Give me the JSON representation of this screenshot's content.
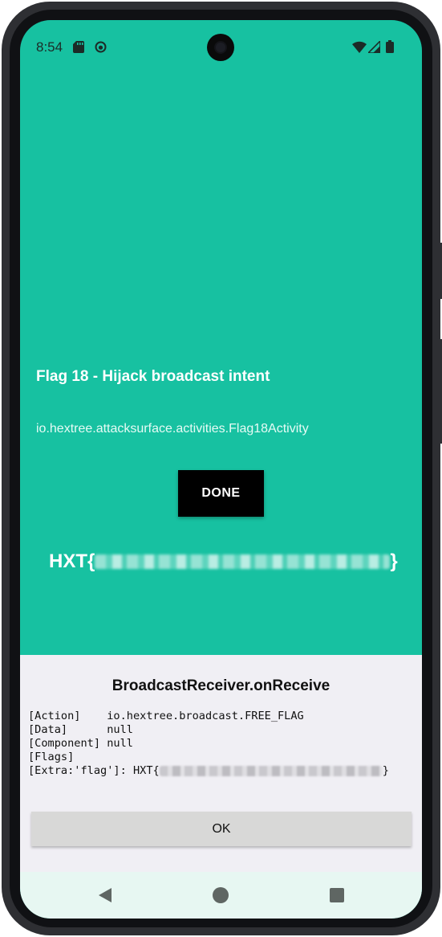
{
  "status_bar": {
    "time": "8:54",
    "left_icons": [
      "sd-card-icon",
      "sync-face-icon"
    ],
    "right_icons": [
      "wifi-icon",
      "cellular-signal-icon",
      "battery-icon"
    ]
  },
  "app": {
    "title": "Flag 18 - Hijack broadcast intent",
    "activity_class": "io.hextree.attacksurface.activities.Flag18Activity",
    "done_label": "DONE",
    "flag_prefix": "HXT{",
    "flag_suffix": "}",
    "background_color": "#17c1a1"
  },
  "dialog": {
    "title": "BroadcastReceiver.onReceive",
    "lines": [
      "[Action]    io.hextree.broadcast.FREE_FLAG",
      "[Data]      null",
      "[Component] null",
      "[Flags]"
    ],
    "extra_prefix": "[Extra:'flag']: HXT{",
    "extra_suffix": "}",
    "ok_label": "OK"
  },
  "nav_bar": {
    "icons": [
      "back-icon",
      "home-icon",
      "recents-icon"
    ]
  }
}
